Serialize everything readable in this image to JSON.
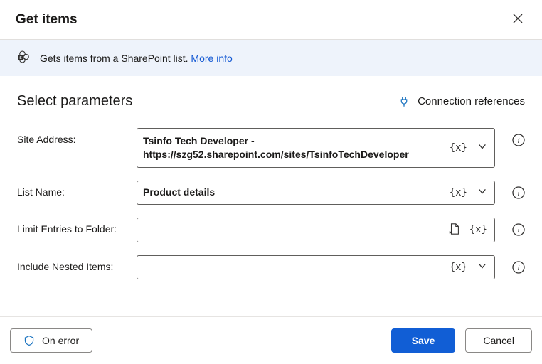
{
  "header": {
    "title": "Get items"
  },
  "infobar": {
    "text": "Gets items from a SharePoint list.",
    "more_info": "More info"
  },
  "section": {
    "title": "Select parameters",
    "connection_references": "Connection references"
  },
  "fields": {
    "site_address": {
      "label": "Site Address:",
      "value": "Tsinfo Tech Developer - https://szg52.sharepoint.com/sites/TsinfoTechDeveloper",
      "fx": "{x}"
    },
    "list_name": {
      "label": "List Name:",
      "value": "Product details",
      "fx": "{x}"
    },
    "limit_folder": {
      "label": "Limit Entries to Folder:",
      "value": "",
      "fx": "{x}"
    },
    "include_nested": {
      "label": "Include Nested Items:",
      "value": "",
      "fx": "{x}"
    }
  },
  "footer": {
    "on_error": "On error",
    "save": "Save",
    "cancel": "Cancel"
  }
}
